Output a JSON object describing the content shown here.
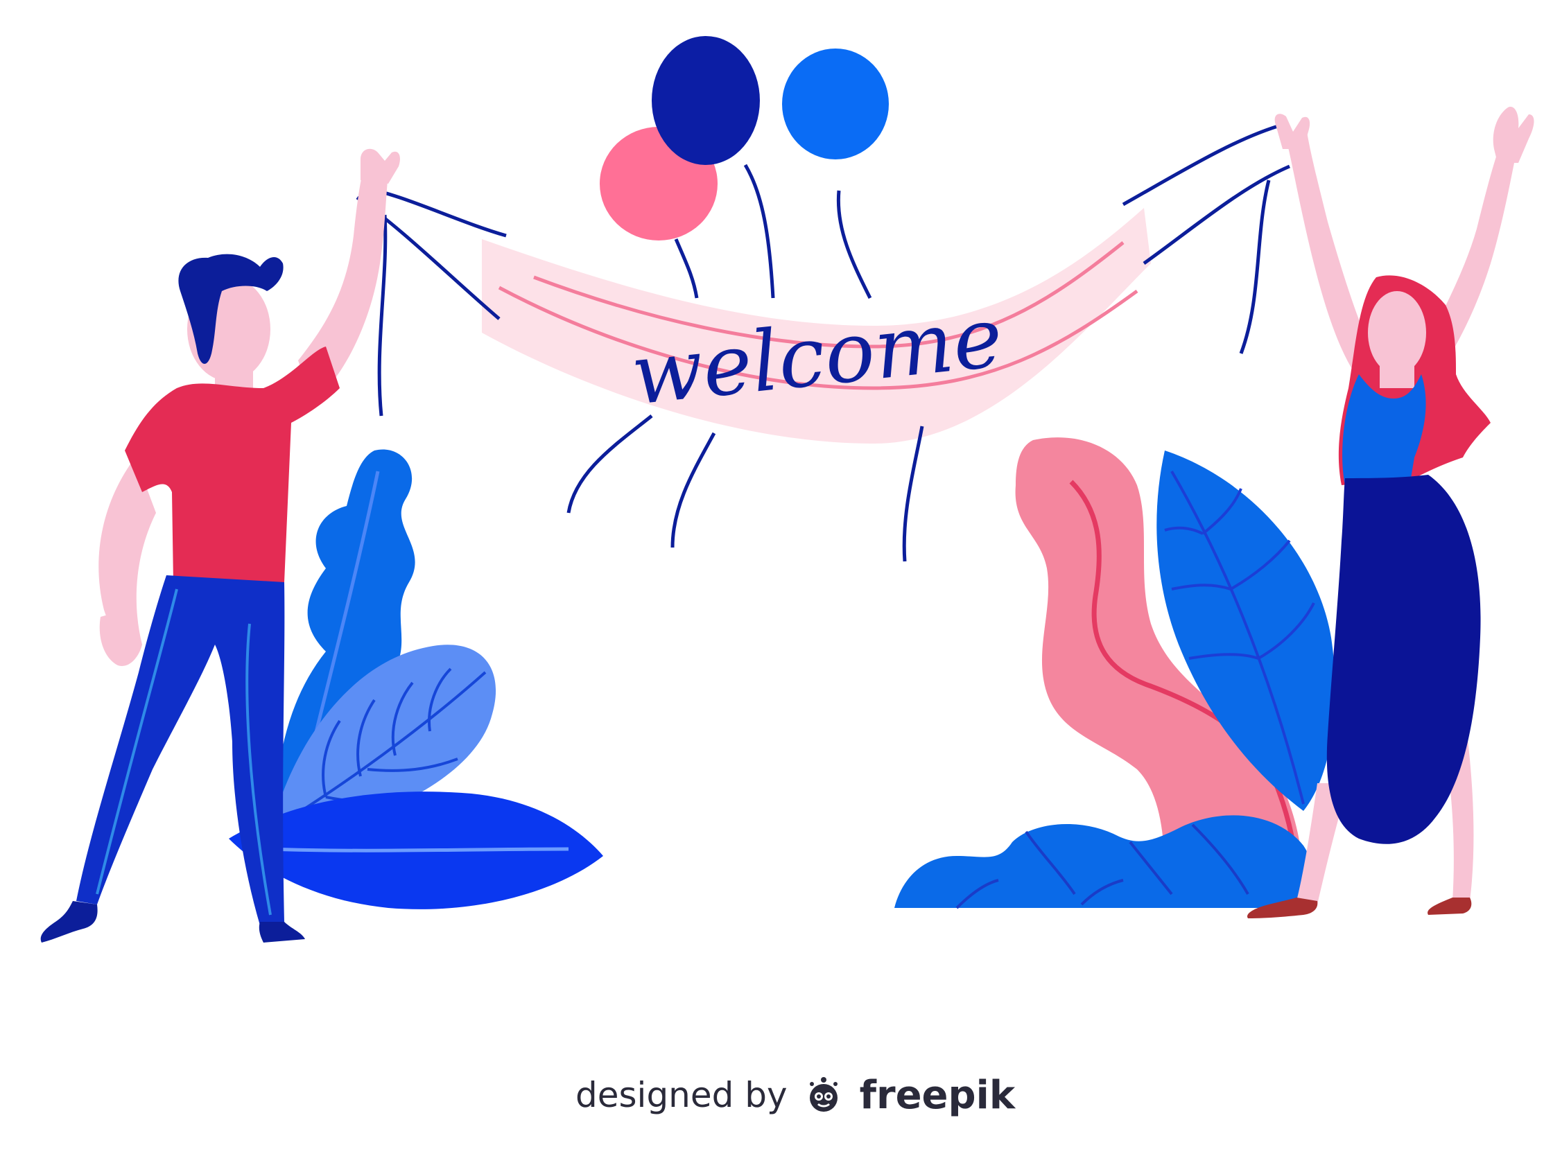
{
  "banner": {
    "text": "welcome"
  },
  "credit": {
    "designed_by": "designed by",
    "brand": "freepik",
    "logo_icon": "freepik-logo-icon"
  },
  "colors": {
    "man_shirt": "#e42c54",
    "man_pants": "#0f2fc8",
    "man_hair": "#0c1e9a",
    "skin": "#f8c3d4",
    "woman_hair": "#e42c54",
    "woman_top": "#0a64e6",
    "woman_skirt": "#0b1496",
    "banner": "#fde1e8",
    "banner_stripe": "#f47d9c",
    "balloon_pink": "#ff7096",
    "balloon_navy": "#0c1ea5",
    "balloon_blue": "#0a6cf5",
    "leaf_blue": "#0a6ae8",
    "leaf_light": "#5c8ef5",
    "leaf_royal": "#0a38f0",
    "leaf_pink": "#f4869e"
  }
}
